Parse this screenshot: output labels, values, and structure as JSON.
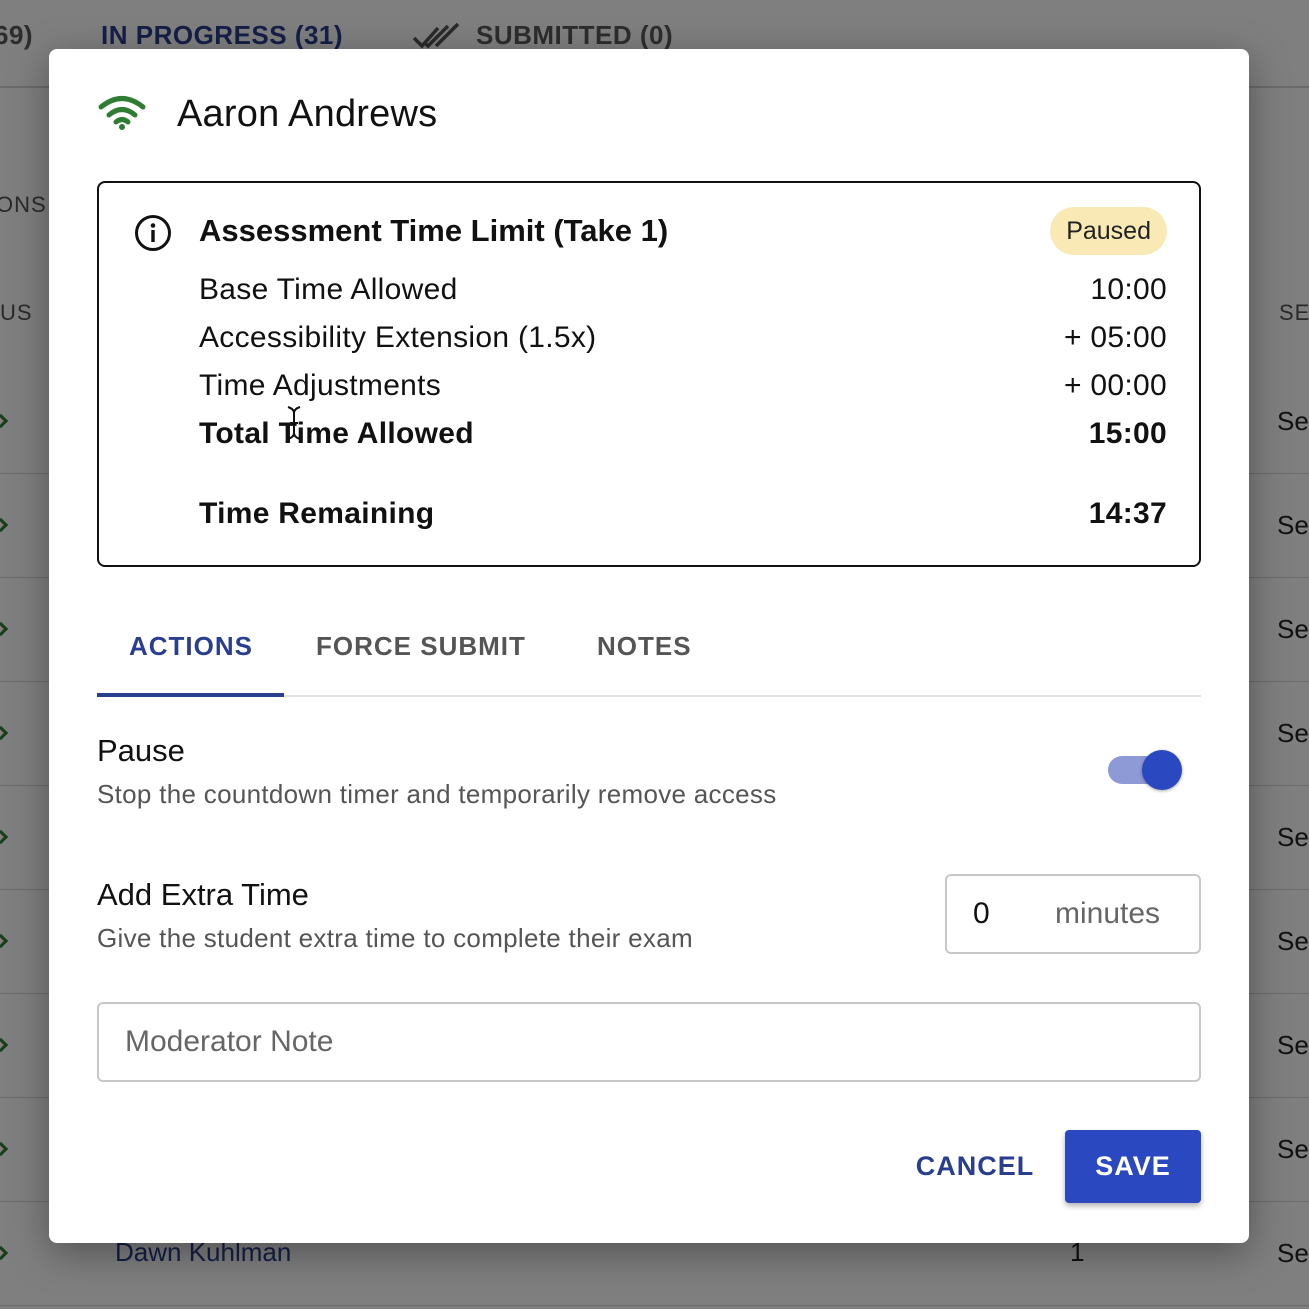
{
  "background": {
    "tabs": {
      "left_cut": "69)",
      "in_progress": "IN PROGRESS (31)",
      "submitted": "SUBMITTED (0)"
    },
    "col_left_fragment_1": "ONS",
    "col_left_fragment_2": "US",
    "col_right_fragment": "SE",
    "row_fragment": "Se",
    "last_row": {
      "name": "Dawn Kuhlman",
      "count": "1"
    }
  },
  "dialog": {
    "title": "Aaron Andrews",
    "connection_icon": "wifi-icon",
    "connection_color": "#2e7d32",
    "time_limit": {
      "title": "Assessment Time Limit (Take 1)",
      "status_badge": "Paused",
      "rows": [
        {
          "label": "Base Time Allowed",
          "value": "10:00"
        },
        {
          "label": "Accessibility Extension (1.5x)",
          "value": "+ 05:00"
        },
        {
          "label": "Time Adjustments",
          "value": "+ 00:00"
        },
        {
          "label": "Total Time Allowed",
          "value": "15:00"
        }
      ],
      "remaining_label": "Time Remaining",
      "remaining_value": "14:37"
    },
    "tabs": [
      {
        "label": "ACTIONS",
        "active": true
      },
      {
        "label": "FORCE SUBMIT",
        "active": false
      },
      {
        "label": "NOTES",
        "active": false
      }
    ],
    "pause": {
      "title": "Pause",
      "description": "Stop the countdown timer and temporarily remove access",
      "enabled": true
    },
    "extra_time": {
      "title": "Add Extra Time",
      "description": "Give the student extra time to complete their exam",
      "value": "0",
      "unit": "minutes"
    },
    "moderator_note": {
      "placeholder": "Moderator Note",
      "value": ""
    },
    "buttons": {
      "cancel": "CANCEL",
      "save": "SAVE"
    },
    "accent_color": "#2a48bf"
  }
}
